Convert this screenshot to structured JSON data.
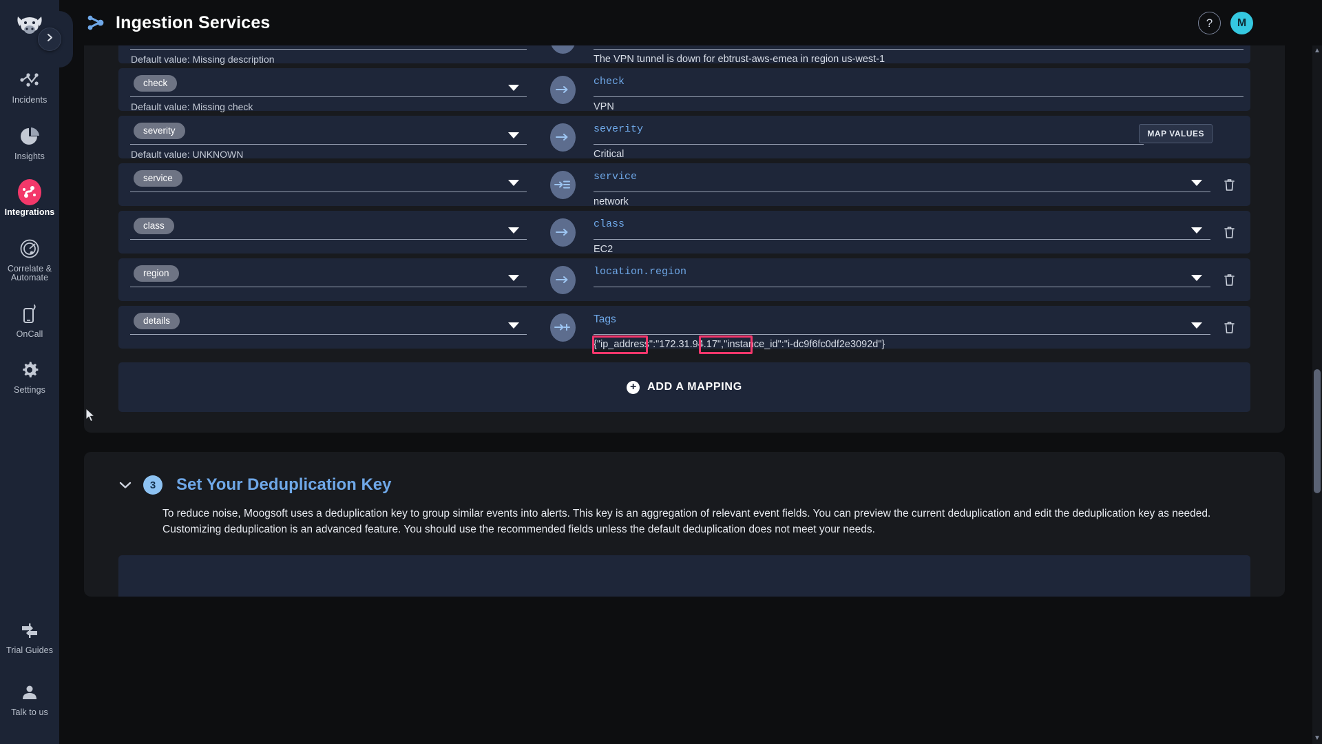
{
  "sidebar": {
    "logo_icon": "moogsoft-cow-logo",
    "collapse_icon": "chevron-right-icon",
    "items": [
      {
        "label": "Incidents",
        "icon": "incidents-nodes-icon",
        "active": false
      },
      {
        "label": "Insights",
        "icon": "pie-chart-icon",
        "active": false
      },
      {
        "label": "Integrations",
        "icon": "integrations-link-icon",
        "active": true
      },
      {
        "label": "Correlate & Automate",
        "icon": "radar-target-icon",
        "active": false
      },
      {
        "label": "OnCall",
        "icon": "mobile-phone-icon",
        "active": false
      },
      {
        "label": "Settings",
        "icon": "gear-icon",
        "active": false
      }
    ],
    "bottom_items": [
      {
        "label": "Trial Guides",
        "icon": "signpost-icon"
      },
      {
        "label": "Talk to us",
        "icon": "person-headset-icon"
      }
    ]
  },
  "header": {
    "title": "Ingestion Services",
    "title_icon": "share-nodes-icon",
    "help_label": "?",
    "help_icon": "question-mark-icon",
    "avatar_initial": "M"
  },
  "mappings": {
    "rows": [
      {
        "partial": true,
        "source_pill": "",
        "source_default": "Default value: Missing description",
        "target_label": "",
        "target_value": "The VPN tunnel is down for ebtrust-aws-emea in region us-west-1",
        "arrow_icon": "arrow-right-icon",
        "has_caret_left": false,
        "has_caret_right": false,
        "has_trash": false,
        "has_map_values": false
      },
      {
        "partial": false,
        "source_pill": "check",
        "source_default": "Default value: Missing check",
        "target_label": "check",
        "target_value": "VPN",
        "arrow_icon": "arrow-right-icon",
        "has_caret_left": true,
        "has_caret_right": false,
        "has_trash": false,
        "has_map_values": false
      },
      {
        "partial": false,
        "source_pill": "severity",
        "source_default": "Default value: UNKNOWN",
        "target_label": "severity",
        "target_value": "Critical",
        "arrow_icon": "arrow-right-icon",
        "has_caret_left": true,
        "has_caret_right": false,
        "has_trash": false,
        "has_map_values": true,
        "map_values_label": "MAP VALUES"
      },
      {
        "partial": false,
        "source_pill": "service",
        "source_default": "",
        "target_label": "service",
        "target_value": "network",
        "arrow_icon": "arrow-to-list-icon",
        "has_caret_left": true,
        "has_caret_right": true,
        "has_trash": true,
        "has_map_values": false
      },
      {
        "partial": false,
        "source_pill": "class",
        "source_default": "",
        "target_label": "class",
        "target_value": "EC2",
        "arrow_icon": "arrow-right-icon",
        "has_caret_left": true,
        "has_caret_right": true,
        "has_trash": true,
        "has_map_values": false
      },
      {
        "partial": false,
        "source_pill": "region",
        "source_default": "",
        "target_label": "location.region",
        "target_value": "",
        "arrow_icon": "arrow-right-icon",
        "has_caret_left": true,
        "has_caret_right": true,
        "has_trash": true,
        "has_map_values": false
      },
      {
        "partial": false,
        "source_pill": "details",
        "source_default": "",
        "target_label": "Tags",
        "target_label_sans": true,
        "target_value": "{\"ip_address\":\"172.31.94.17\",\"instance_id\":\"i-dc9f6fc0df2e3092d\"}",
        "arrow_icon": "arrow-plus-icon",
        "has_caret_left": true,
        "has_caret_right": true,
        "has_trash": true,
        "has_map_values": false
      }
    ],
    "add_mapping_label": "ADD A MAPPING",
    "add_mapping_icon": "plus-circle-icon",
    "highlight_color": "#f4376c",
    "highlights": [
      {
        "label": "ip_address-key-highlight"
      },
      {
        "label": "instance_id-key-highlight"
      }
    ]
  },
  "dedup": {
    "step_number": "3",
    "title": "Set Your Deduplication Key",
    "chevron_icon": "chevron-down-icon",
    "body": "To reduce noise, Moogsoft uses a deduplication key to group similar events into alerts. This key is an aggregation of relevant event fields. You can preview the current deduplication and edit the deduplication key as needed. Customizing deduplication is an advanced feature. You should use the recommended fields unless the default deduplication does not meet your needs."
  },
  "colors": {
    "accent_blue": "#6fa8e8",
    "brand_pink": "#f3386a",
    "panel_bg": "#181a1e",
    "row_bg": "#1e2639",
    "sidebar_bg": "#1c2435"
  }
}
